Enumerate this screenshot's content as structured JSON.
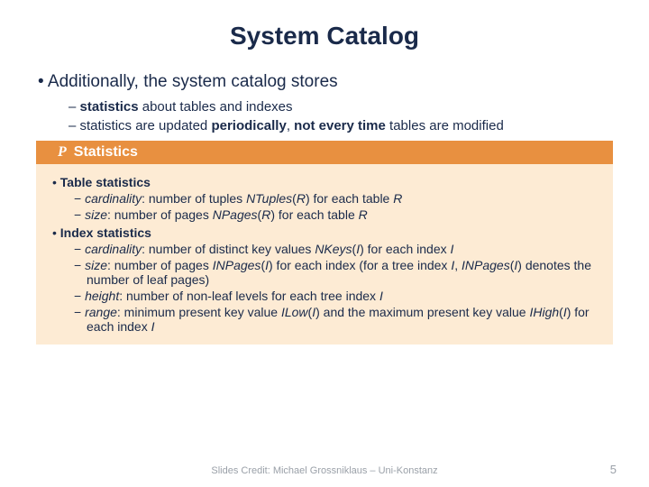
{
  "title": "System Catalog",
  "intro": "Additionally, the system catalog stores",
  "sub1_a": "statistics",
  "sub1_b": " about tables and indexes",
  "sub2_a": "statistics are updated ",
  "sub2_b": "periodically",
  "sub2_c": ", ",
  "sub2_d": "not every time",
  "sub2_e": " tables are modified",
  "box_icon": "P",
  "box_title": "Statistics",
  "ts_head": "Table statistics",
  "ts1_a": "cardinality",
  "ts1_b": ": number of tuples ",
  "ts1_c": "NTuples",
  "ts1_d": "(",
  "ts1_e": "R",
  "ts1_f": ") for each table ",
  "ts1_g": "R",
  "ts2_a": "size",
  "ts2_b": ": number of pages ",
  "ts2_c": "NPages",
  "ts2_d": "(",
  "ts2_e": "R",
  "ts2_f": ") for each table ",
  "ts2_g": "R",
  "is_head": "Index statistics",
  "is1_a": "cardinality",
  "is1_b": ": number of distinct key values ",
  "is1_c": "NKeys",
  "is1_d": "(",
  "is1_e": "I",
  "is1_f": ") for each index ",
  "is1_g": "I",
  "is2_a": "size",
  "is2_b": ": number of pages ",
  "is2_c": "INPages",
  "is2_d": "(",
  "is2_e": "I",
  "is2_f": ") for each index (for a tree index ",
  "is2_g": "I",
  "is2_h": ", ",
  "is2_i": "INPages",
  "is2_j": "(",
  "is2_k": "I",
  "is2_l": ") denotes the number of leaf pages)",
  "is3_a": "height",
  "is3_b": ": number of non-leaf levels for each tree index ",
  "is3_c": "I",
  "is4_a": "range",
  "is4_b": ": minimum present key value ",
  "is4_c": "ILow",
  "is4_d": "(",
  "is4_e": "I",
  "is4_f": ") and the maximum present key value ",
  "is4_g": "IHigh",
  "is4_h": "(",
  "is4_i": "I",
  "is4_j": ") for each index ",
  "is4_k": "I",
  "footer": "Slides Credit: Michael Grossniklaus – Uni-Konstanz",
  "pagenum": "5"
}
